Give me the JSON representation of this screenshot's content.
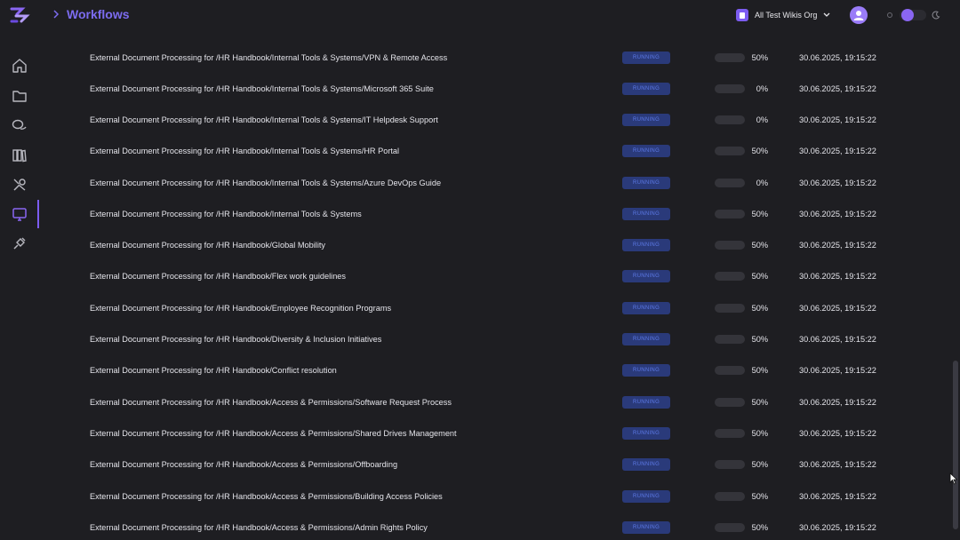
{
  "header": {
    "title": "Workflows",
    "org_name": "All Test Wikis Org"
  },
  "sidebar": {
    "items": [
      {
        "name": "home-icon"
      },
      {
        "name": "folder-icon"
      },
      {
        "name": "chat-icon"
      },
      {
        "name": "library-icon"
      },
      {
        "name": "tools-icon"
      },
      {
        "name": "monitor-icon",
        "active": true
      },
      {
        "name": "integrations-icon"
      }
    ]
  },
  "colors": {
    "accent": "#7c5cf0",
    "status_bg": "#2a3a7a",
    "status_text": "#5d7ae8",
    "background": "#1e1e22"
  },
  "rows": [
    {
      "name": "External Document Processing for /HR Handbook/Internal Tools & Systems/VPN & Remote Access",
      "status": "RUNNING",
      "progress": 50,
      "progress_label": "50%",
      "date": "30.06.2025, 19:15:22"
    },
    {
      "name": "External Document Processing for /HR Handbook/Internal Tools & Systems/Microsoft 365 Suite",
      "status": "RUNNING",
      "progress": 0,
      "progress_label": "0%",
      "date": "30.06.2025, 19:15:22"
    },
    {
      "name": "External Document Processing for /HR Handbook/Internal Tools & Systems/IT Helpdesk Support",
      "status": "RUNNING",
      "progress": 0,
      "progress_label": "0%",
      "date": "30.06.2025, 19:15:22"
    },
    {
      "name": "External Document Processing for /HR Handbook/Internal Tools & Systems/HR Portal",
      "status": "RUNNING",
      "progress": 50,
      "progress_label": "50%",
      "date": "30.06.2025, 19:15:22"
    },
    {
      "name": "External Document Processing for /HR Handbook/Internal Tools & Systems/Azure DevOps Guide",
      "status": "RUNNING",
      "progress": 0,
      "progress_label": "0%",
      "date": "30.06.2025, 19:15:22"
    },
    {
      "name": "External Document Processing for /HR Handbook/Internal Tools & Systems",
      "status": "RUNNING",
      "progress": 50,
      "progress_label": "50%",
      "date": "30.06.2025, 19:15:22"
    },
    {
      "name": "External Document Processing for /HR Handbook/Global Mobility",
      "status": "RUNNING",
      "progress": 50,
      "progress_label": "50%",
      "date": "30.06.2025, 19:15:22"
    },
    {
      "name": "External Document Processing for /HR Handbook/Flex work guidelines",
      "status": "RUNNING",
      "progress": 50,
      "progress_label": "50%",
      "date": "30.06.2025, 19:15:22"
    },
    {
      "name": "External Document Processing for /HR Handbook/Employee Recognition Programs",
      "status": "RUNNING",
      "progress": 50,
      "progress_label": "50%",
      "date": "30.06.2025, 19:15:22"
    },
    {
      "name": "External Document Processing for /HR Handbook/Diversity & Inclusion Initiatives",
      "status": "RUNNING",
      "progress": 50,
      "progress_label": "50%",
      "date": "30.06.2025, 19:15:22"
    },
    {
      "name": "External Document Processing for /HR Handbook/Conflict resolution",
      "status": "RUNNING",
      "progress": 50,
      "progress_label": "50%",
      "date": "30.06.2025, 19:15:22"
    },
    {
      "name": "External Document Processing for /HR Handbook/Access & Permissions/Software Request Process",
      "status": "RUNNING",
      "progress": 50,
      "progress_label": "50%",
      "date": "30.06.2025, 19:15:22"
    },
    {
      "name": "External Document Processing for /HR Handbook/Access & Permissions/Shared Drives Management",
      "status": "RUNNING",
      "progress": 50,
      "progress_label": "50%",
      "date": "30.06.2025, 19:15:22"
    },
    {
      "name": "External Document Processing for /HR Handbook/Access & Permissions/Offboarding",
      "status": "RUNNING",
      "progress": 50,
      "progress_label": "50%",
      "date": "30.06.2025, 19:15:22"
    },
    {
      "name": "External Document Processing for /HR Handbook/Access & Permissions/Building Access Policies",
      "status": "RUNNING",
      "progress": 50,
      "progress_label": "50%",
      "date": "30.06.2025, 19:15:22"
    },
    {
      "name": "External Document Processing for /HR Handbook/Access & Permissions/Admin Rights Policy",
      "status": "RUNNING",
      "progress": 50,
      "progress_label": "50%",
      "date": "30.06.2025, 19:15:22"
    }
  ]
}
